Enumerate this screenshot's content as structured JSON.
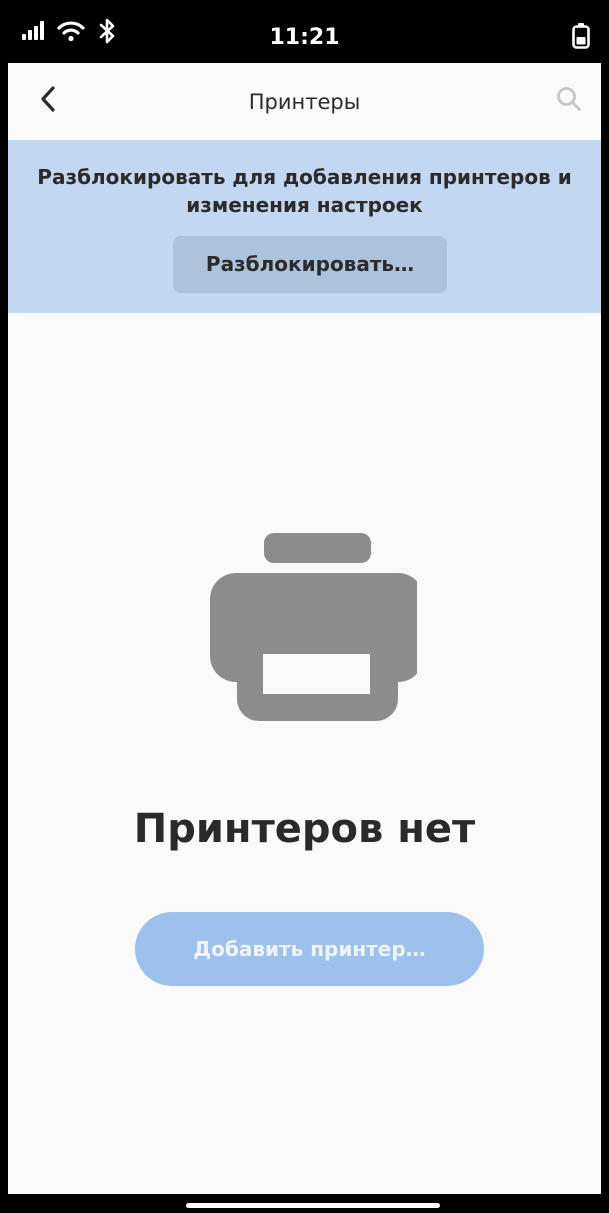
{
  "status_bar": {
    "time": "11:21",
    "icons": [
      "signal-icon",
      "wifi-icon",
      "bluetooth-icon",
      "battery-icon"
    ]
  },
  "header": {
    "title": "Принтеры",
    "back_icon": "chevron-left-icon",
    "search_icon": "search-icon"
  },
  "unlock_banner": {
    "text": "Разблокировать для добавления принтеров и изменения настроек",
    "button_label": "Разблокировать…"
  },
  "empty_state": {
    "icon": "printer-icon",
    "title": "Принтеров нет",
    "add_button_label": "Добавить принтер…"
  },
  "colors": {
    "banner_bg": "#c2d7f1",
    "unlock_button_bg": "#adc2db",
    "add_button_bg": "#9ec0ec",
    "icon_gray": "#8c8c8c",
    "page_bg": "#fafafa"
  }
}
